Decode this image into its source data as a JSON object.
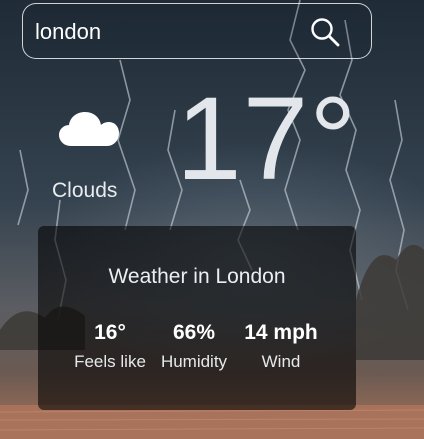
{
  "search": {
    "value": "london",
    "placeholder": ""
  },
  "icons": {
    "search": "search-icon",
    "weather": "cloud-icon"
  },
  "current": {
    "condition": "Clouds",
    "temperature": "17°"
  },
  "details": {
    "title": "Weather in London",
    "feels_like_value": "16°",
    "feels_like_label": "Feels like",
    "humidity_value": "66%",
    "humidity_label": "Humidity",
    "wind_value": "14 mph",
    "wind_label": "Wind"
  },
  "colors": {
    "sky_top": "#1e2a34",
    "sky_mid": "#3b4a57",
    "ground": "#9c6a52",
    "card_bg": "#000000"
  }
}
